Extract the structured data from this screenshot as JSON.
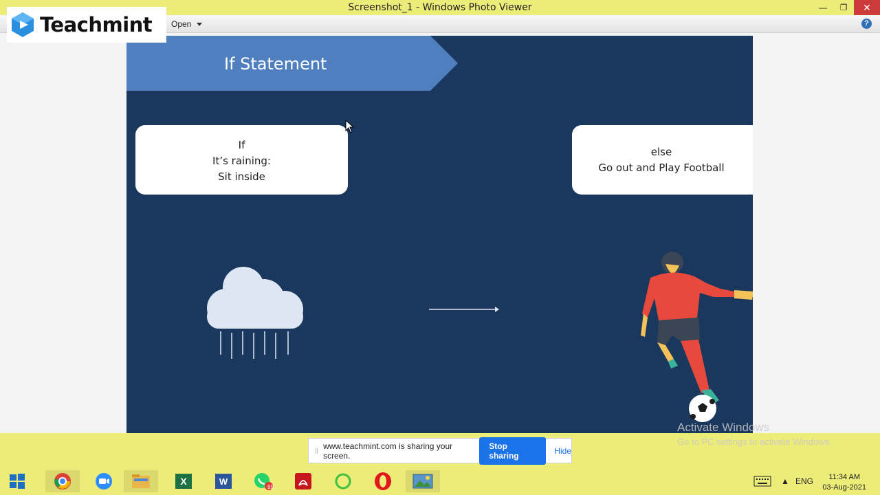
{
  "window": {
    "title": "Screenshot_1 - Windows Photo Viewer",
    "menu_open_label": "Open",
    "help_label": "?"
  },
  "logo": {
    "name": "Teachmint"
  },
  "slide": {
    "banner_title": "If Statement",
    "if_box": {
      "line1": "If",
      "line2": "It’s raining:",
      "line3": "Sit inside"
    },
    "else_box": {
      "line1": "else",
      "line2": "Go out and Play Football"
    }
  },
  "watermark": {
    "line1": "Activate Windows",
    "line2": "Go to PC settings to activate Windows."
  },
  "share_bar": {
    "message": "www.teachmint.com is sharing your screen.",
    "stop_label": "Stop sharing",
    "hide_label": "Hide"
  },
  "taskbar": {
    "apps": [
      "windows-start-icon",
      "chrome-icon",
      "zoom-icon",
      "file-explorer-icon",
      "excel-icon",
      "word-icon",
      "whatsapp-icon",
      "acrobat-icon",
      "green-app-icon",
      "opera-icon",
      "photo-viewer-icon"
    ],
    "whatsapp_badge": "99",
    "language": "ENG",
    "time": "11:34 AM",
    "date": "03-Aug-2021"
  },
  "colors": {
    "titlebar": "#ecec78",
    "slide_bg": "#1a375d",
    "banner": "#4f7fbf",
    "stop_button": "#1a73e8"
  }
}
